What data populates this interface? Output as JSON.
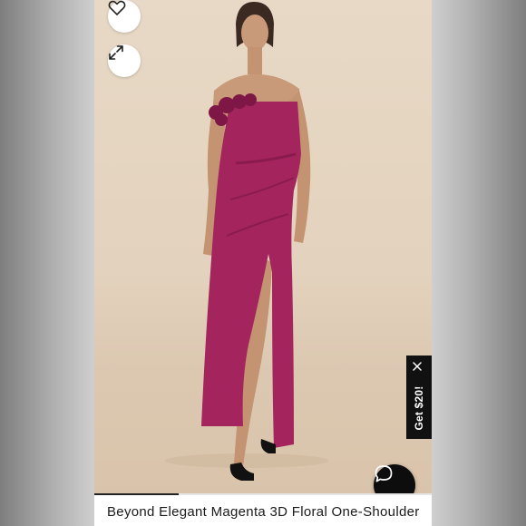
{
  "product": {
    "title": "Beyond Elegant Magenta 3D Floral One-Shoulder"
  },
  "actions": {
    "favorite_icon": "heart-outline-icon",
    "expand_icon": "expand-arrows-icon"
  },
  "promo": {
    "label": "Get $20!",
    "close_icon": "close-icon"
  },
  "chat": {
    "icon": "chat-bubble-icon"
  },
  "gallery": {
    "progress_fraction": 0.25
  },
  "colors": {
    "dress": "#a4245e",
    "promo_bg": "#111111",
    "chat_bg": "#0d0d0d",
    "backdrop": "#e5d6c2"
  }
}
